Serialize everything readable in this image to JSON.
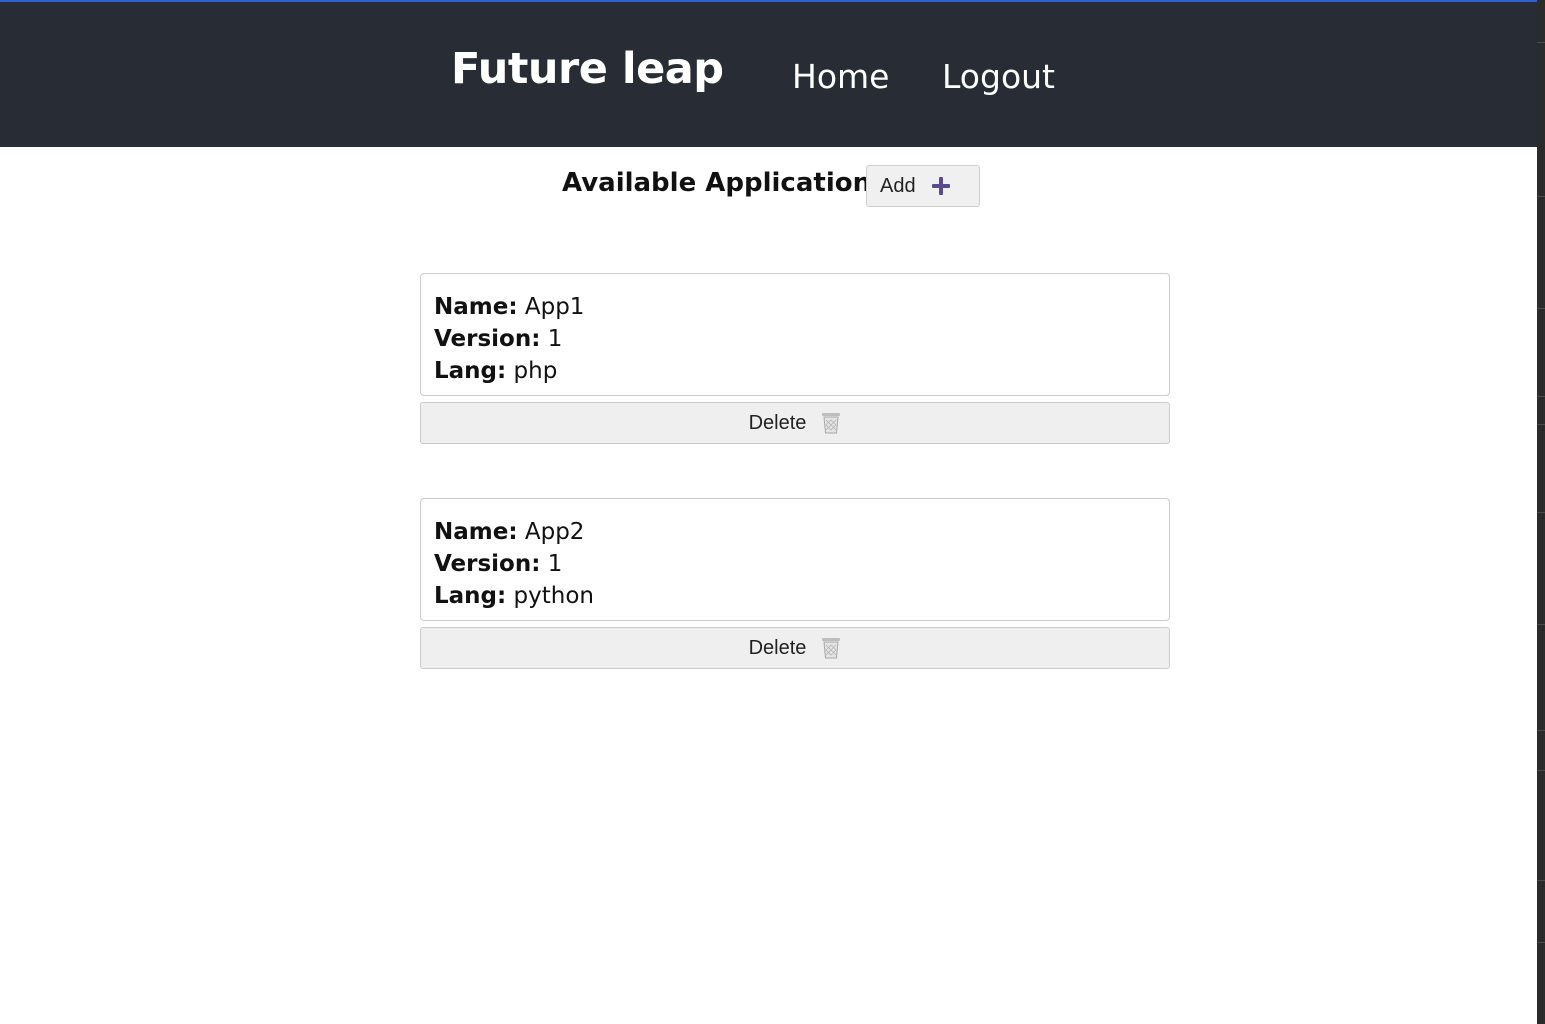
{
  "header": {
    "brand": "Future leap",
    "nav": {
      "home": "Home",
      "logout": "Logout"
    }
  },
  "main": {
    "title": "Available Applications",
    "add_label": "Add",
    "add_icon": "plus-icon",
    "labels": {
      "name": "Name:",
      "version": "Version:",
      "lang": "Lang:"
    },
    "apps": [
      {
        "name": "App1",
        "version": "1",
        "lang": "php",
        "delete_label": "Delete",
        "delete_icon": "trash-icon"
      },
      {
        "name": "App2",
        "version": "1",
        "lang": "python",
        "delete_label": "Delete",
        "delete_icon": "trash-icon"
      }
    ]
  },
  "colors": {
    "header_bg": "#282c34",
    "accent": "#2f5fd0",
    "plus_icon": "#5b4a8c"
  }
}
